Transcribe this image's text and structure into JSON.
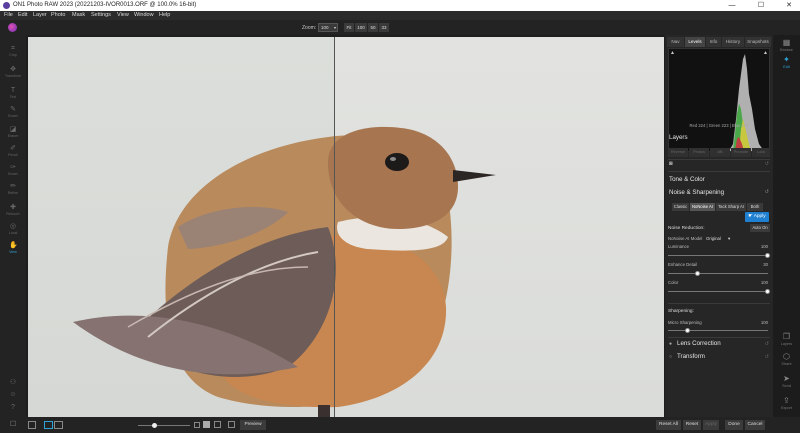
{
  "window": {
    "title": "ON1 Photo RAW 2023 (20221203-IVOR0013.ORF @ 100.0% 16-bit)",
    "min_glyph": "—",
    "max_glyph": "☐",
    "close_glyph": "✕"
  },
  "menu": [
    "File",
    "Edit",
    "Layer",
    "Photo",
    "Mask",
    "Settings",
    "View",
    "Window",
    "Help"
  ],
  "toolbar": {
    "zoom_label": "Zoom:",
    "zoom_value": "100",
    "zoom_buttons": [
      "Fit",
      "100",
      "50",
      "33"
    ]
  },
  "left_tools": [
    {
      "label": "Crop",
      "icon": "crop-icon"
    },
    {
      "label": "Transform",
      "icon": "transform-icon"
    },
    {
      "label": "Text",
      "icon": "text-icon"
    },
    {
      "label": "Brush",
      "icon": "brush-icon"
    },
    {
      "label": "Eraser",
      "icon": "eraser-icon"
    },
    {
      "label": "Pencil",
      "icon": "pencil-icon"
    },
    {
      "label": "Brush",
      "icon": "adjust-brush-icon"
    },
    {
      "label": "Refine",
      "icon": "refine-icon"
    },
    {
      "label": "Retouch",
      "icon": "retouch-icon"
    },
    {
      "label": "Local",
      "icon": "local-icon"
    },
    {
      "label": "View",
      "icon": "view-icon",
      "active": true
    }
  ],
  "right_panel": {
    "tabs": [
      "Nav",
      "Levels",
      "Info",
      "History",
      "Snapshots"
    ],
    "active_tab": "Levels",
    "rgb_readout": "Red 224 | Green 223 | Blue 226",
    "layers_title": "Layers",
    "layer_buttons": [
      "Reverse",
      "Photos",
      "AB",
      "Promote",
      "Lock"
    ],
    "tone_color": "Tone & Color",
    "noise_sharpening": "Noise & Sharpening",
    "modes": [
      "Classic",
      "NoNoise AI",
      "Tack Sharp AI",
      "Both"
    ],
    "active_mode": "NoNoise AI",
    "apply_label": "Apply",
    "noise_reduction": "Noise Reduction:",
    "auto_on": "Auto On",
    "model_label": "NoNoise AI Model",
    "model_value": "Original",
    "sliders": [
      {
        "label": "Luminance",
        "value": "100",
        "fraction": 1.0
      },
      {
        "label": "Enhance Detail",
        "value": "30",
        "fraction": 0.3
      },
      {
        "label": "Color",
        "value": "100",
        "fraction": 1.0
      }
    ],
    "sharpening_title": "Sharpening:",
    "micro_label": "Micro Sharpening",
    "micro_value": "100",
    "micro_fraction": 0.2,
    "lens_correction": "Lens Correction",
    "transform": "Transform"
  },
  "far_right": [
    {
      "label": "Browse",
      "icon": "browse-icon"
    },
    {
      "label": "Edit",
      "icon": "edit-icon",
      "active": true
    },
    {
      "label": "Layers",
      "icon": "layers-icon"
    },
    {
      "label": "Share",
      "icon": "share-icon"
    },
    {
      "label": "Send",
      "icon": "send-icon"
    },
    {
      "label": "Export",
      "icon": "export-icon"
    }
  ],
  "bottom": {
    "preview": "Preview",
    "reset_all": "Reset All",
    "reset": "Reset",
    "done": "Done",
    "cancel": "Cancel",
    "extra": "Apply"
  },
  "colors": {
    "accent": "#2ea3d8",
    "apply_blue": "#1f7fd1"
  }
}
